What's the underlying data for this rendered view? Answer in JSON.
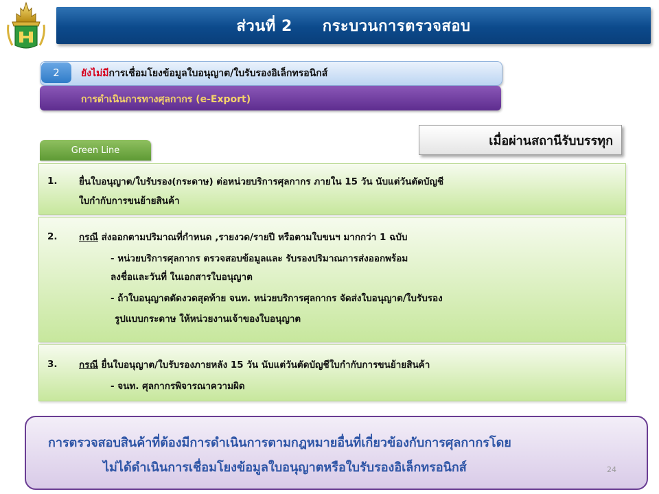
{
  "title": {
    "part": "ส่วนที่ 2",
    "topic": "กระบวนการตรวจสอบ"
  },
  "subtitle": {
    "number": "2",
    "highlight": "ยังไม่มี",
    "text": "การเชื่อมโยงข้อมูลใบอนุญาต/ใบรับรองอิเล็กทรอนิกส์"
  },
  "customs_bar": "การดำเนินการทางศุลกากร (e-Export)",
  "checkpoint": "เมื่อผ่านสถานีรับบรรทุก",
  "green_tab": "Green Line",
  "items": [
    {
      "number": "1.",
      "line1": "ยื่นใบอนุญาต/ใบรับรอง(กระดาษ) ต่อหน่วยบริการศุลกากร ภายใน 15 วัน นับแต่วันตัดบัญชี",
      "line2": "ใบกำกับการขนย้ายสินค้า"
    },
    {
      "number": "2.",
      "case": "กรณี",
      "head": " ส่งออกตามปริมาณที่กำหนด ,รายงวด/รายปี หรือตามใบขนฯ มากกว่า 1 ฉบับ",
      "sub1": "- หน่วยบริการศุลกากร ตรวจสอบข้อมูลและ รับรองปริมาณการส่งออกพร้อม",
      "sub1b": "ลงชื่อและวันที่ ในเอกสารใบอนุญาต",
      "sub2": "- ถ้าใบอนุญาตตัดงวดสุดท้าย จนท. หน่วยบริการศุลกากร จัดส่งใบอนุญาต/ใบรับรอง",
      "sub2b": "รูปแบบกระดาษ ให้หน่วยงานเจ้าของใบอนุญาต"
    },
    {
      "number": "3.",
      "case": "กรณี",
      "head": " ยื่นใบอนุญาต/ใบรับรองภายหลัง 15 วัน นับแต่วันตัดบัญชีใบกำกับการขนย้ายสินค้า",
      "sub1": "- จนท. ศุลกากรพิจารณาความผิด"
    }
  ],
  "note": {
    "line1": "การตรวจสอบสินค้าที่ต้องมีการดำเนินการตามกฎหมายอื่นที่เกี่ยวข้องกับการศุลกากรโดย",
    "line2": "ไม่ได้ดำเนินการเชื่อมโยงข้อมูลใบอนุญาตหรือใบรับรองอิเล็กทรอนิกส์"
  },
  "page_number": "24",
  "colors": {
    "title_blue": "#0c4a8c",
    "highlight_red": "#d6001c",
    "purple": "#5e2d8f",
    "green": "#5e9a34",
    "note_blue": "#2e55a6"
  },
  "logo": "customs-emblem-icon"
}
